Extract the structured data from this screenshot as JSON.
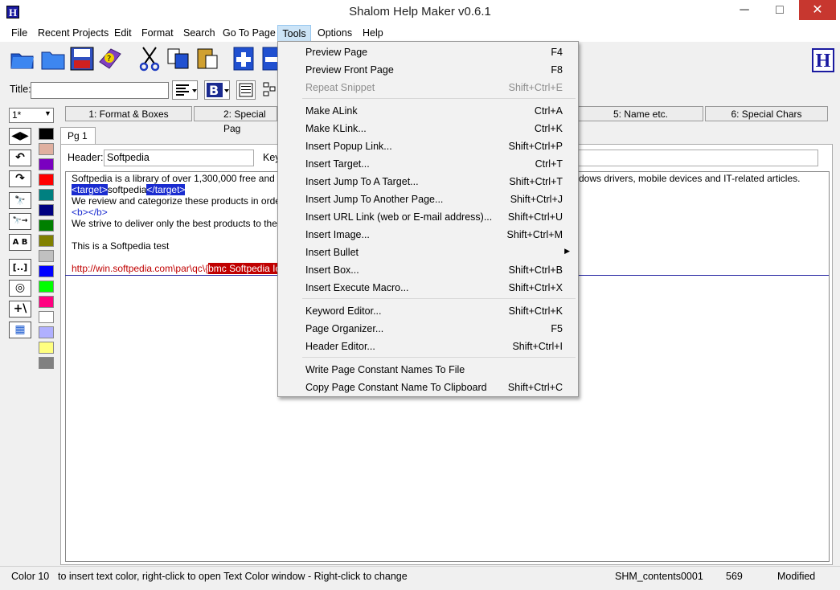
{
  "window": {
    "title": "Shalom Help Maker v0.6.1",
    "minimize": "─",
    "maximize": "□",
    "close": "✕",
    "app_icon": "H"
  },
  "menubar": [
    "File",
    "Recent Projects",
    "Edit",
    "Format",
    "Search",
    "Go To Page",
    "Tools",
    "Options",
    "Help"
  ],
  "toolbar": {
    "icons": [
      "open-folder-icon",
      "folder-icon",
      "save-icon",
      "help-book-icon",
      "cut-icon",
      "copy-icon",
      "paste-icon",
      "add-page-icon",
      "remove-page-icon"
    ],
    "logo": "H"
  },
  "title_row": {
    "label": "Title:",
    "value": ""
  },
  "zoom": {
    "value": "1*"
  },
  "tabs": [
    "1: Format & Boxes",
    "2: Special Pag",
    "5: Name etc.",
    "6: Special Chars"
  ],
  "page_tab": "Pg 1",
  "header": {
    "label": "Header:",
    "value": "Softpedia",
    "keywords_label": "Key"
  },
  "editor": {
    "line1_a": "Softpedia is a library of over 1,300,000 free and free-to",
    "line1_b": "dows drivers, mobile devices and IT-related articles.",
    "line2_tag_open": "<target>",
    "line2_text": "softpedia",
    "line2_tag_close": "</target>",
    "line3": "We review and categorize these products in order to a",
    "line4": "<b></b>",
    "line5": "We strive to deliver only the best products to the visito",
    "line6": "This is a Softpedia test",
    "line7_url": "http://win.softpedia.com\\par\\qc\\{",
    "line7_hl": "bmc Softpedia Icon"
  },
  "swatch_colors": [
    "#000000",
    "#e0b0a0",
    "#7a00c0",
    "#ff0000",
    "#008080",
    "#000080",
    "#008000",
    "#808000",
    "#c0c0c0",
    "#0000ff",
    "#00ff00",
    "#ff0080",
    "#ffffff",
    "#b0b0ff",
    "#ffff80",
    "#808080"
  ],
  "left_tools": [
    "◀▶",
    "↶",
    "↷",
    "🔭",
    "🔭→",
    "A B",
    "[..]",
    "◎",
    "+\\",
    "▦"
  ],
  "tools_menu": {
    "items": [
      {
        "label": "Preview Page",
        "shortcut": "F4"
      },
      {
        "label": "Preview Front Page",
        "shortcut": "F8"
      },
      {
        "label": "Repeat Snippet",
        "shortcut": "Shift+Ctrl+E",
        "disabled": true
      },
      {
        "label": "Make ALink",
        "shortcut": "Ctrl+A"
      },
      {
        "label": "Make KLink...",
        "shortcut": "Ctrl+K"
      },
      {
        "label": "Insert Popup Link...",
        "shortcut": "Shift+Ctrl+P"
      },
      {
        "label": "Insert Target...",
        "shortcut": "Ctrl+T"
      },
      {
        "label": "Insert Jump To A Target...",
        "shortcut": "Shift+Ctrl+T"
      },
      {
        "label": "Insert Jump To Another Page...",
        "shortcut": "Shift+Ctrl+J"
      },
      {
        "label": "Insert URL Link (web or E-mail address)...",
        "shortcut": "Shift+Ctrl+U"
      },
      {
        "label": "Insert Image...",
        "shortcut": "Shift+Ctrl+M"
      },
      {
        "label": "Insert Bullet",
        "shortcut": "",
        "submenu": "▶"
      },
      {
        "label": "Insert Box...",
        "shortcut": "Shift+Ctrl+B"
      },
      {
        "label": "Insert Execute Macro...",
        "shortcut": "Shift+Ctrl+X"
      },
      {
        "label": "Keyword Editor...",
        "shortcut": "Shift+Ctrl+K"
      },
      {
        "label": "Page Organizer...",
        "shortcut": "F5"
      },
      {
        "label": "Header Editor...",
        "shortcut": "Shift+Ctrl+I"
      },
      {
        "label": "Write Page Constant Names To File",
        "shortcut": ""
      },
      {
        "label": "Copy Page Constant Name To Clipboard",
        "shortcut": "Shift+Ctrl+C"
      }
    ]
  },
  "status": {
    "color": "Color 10",
    "hint": "to insert text color, right-click to open Text Color window  - Right-click to change",
    "file": "SHM_contents0001",
    "count": "569",
    "state": "Modified"
  }
}
